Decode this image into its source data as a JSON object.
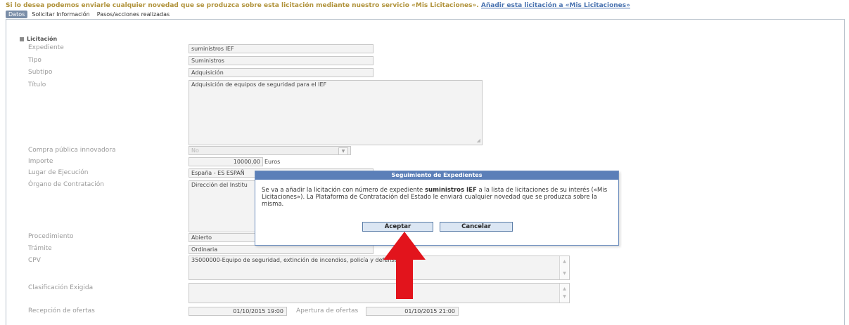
{
  "notice": {
    "text": "Si lo desea podemos enviarle cualquier novedad que se produzca sobre esta licitación mediante nuestro servicio «Mis Licitaciones».",
    "link": "Añadir esta licitación a «Mis Licitaciones»"
  },
  "tabs": [
    "Datos",
    "Solicitar Información",
    "Pasos/acciones realizadas"
  ],
  "section": "Licitación",
  "labels": {
    "expediente": "Expediente",
    "tipo": "Tipo",
    "subtipo": "Subtipo",
    "titulo": "Título",
    "compra": "Compra pública innovadora",
    "importe": "Importe",
    "lugar": "Lugar de Ejecución",
    "organo": "Órgano de Contratación",
    "procedimiento": "Procedimiento",
    "tramite": "Trámite",
    "cpv": "CPV",
    "clasificacion": "Clasificación Exigida",
    "recepcion": "Recepción de ofertas",
    "apertura": "Apertura de ofertas"
  },
  "values": {
    "expediente": "suministros IEF",
    "tipo": "Suministros",
    "subtipo": "Adquisición",
    "titulo": "Adquisición de equipos de seguridad para el IEF",
    "compra": "No",
    "importe": "10000,00",
    "importe_unit": "Euros",
    "lugar": "España - ES ESPAÑ",
    "organo": "Dirección del Institu",
    "procedimiento": "Abierto",
    "tramite": "Ordinaria",
    "cpv": "35000000-Equipo de seguridad, extinción de incendios, policía y defensa.",
    "clasificacion": "",
    "recepcion": "01/10/2015 19:00",
    "apertura": "01/10/2015 21:00"
  },
  "dialog": {
    "title": "Seguimiento de Expedientes",
    "body_pre": "Se va a añadir la licitación con número de expediente",
    "body_bold": "suministros IEF",
    "body_post": "a la lista de licitaciones de su interés («Mis Licitaciones»). La Plataforma de Contratación del Estado le enviará cualquier novedad que se produzca sobre la misma.",
    "accept": "Aceptar",
    "cancel": "Cancelar"
  },
  "colors": {
    "arrow": "#e2141c",
    "dialog_title": "#5b7fb8",
    "notice": "#b0923a",
    "link": "#4a73b0"
  }
}
